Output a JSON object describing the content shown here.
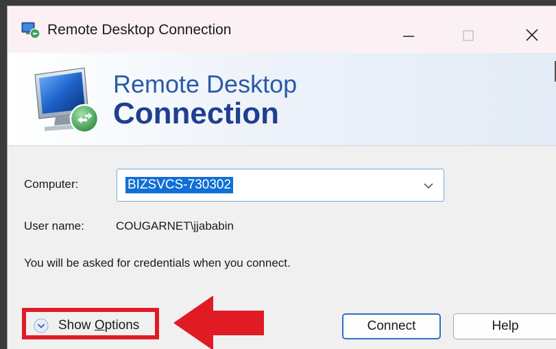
{
  "window": {
    "title": "Remote Desktop Connection",
    "app_icon": "rdc-app-icon"
  },
  "banner": {
    "line1": "Remote Desktop",
    "line2": "Connection",
    "icon": "rdc-monitor-icon"
  },
  "form": {
    "computer_label": "Computer:",
    "computer_value": "BIZSVCS-730302",
    "user_label": "User name:",
    "user_value": "COUGARNET\\jjababin",
    "info_text": "You will be asked for credentials when you connect."
  },
  "buttons": {
    "show_options_prefix": "Show ",
    "show_options_accel": "O",
    "show_options_rest": "ptions",
    "connect": "Connect",
    "help": "Help"
  },
  "annotation": {
    "highlight_color": "#e01b24"
  },
  "colors": {
    "title_bar_bg": "#fbf1f4",
    "selection_bg": "#0f6fd6",
    "banner_text_light": "#2a5aa8",
    "banner_text_dark": "#1f3f8f"
  }
}
